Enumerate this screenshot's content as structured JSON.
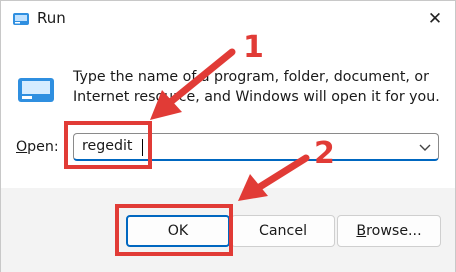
{
  "window": {
    "title": "Run",
    "close_label": "✕",
    "app_icon": "run-icon"
  },
  "body": {
    "icon": "run-icon",
    "description": "Type the name of a program, folder, document, or Internet resource, and Windows will open it for you."
  },
  "open_field": {
    "label_mnemonic": "O",
    "label_rest": "pen:",
    "value": "regedit",
    "dropdown_icon": "chevron-down-icon"
  },
  "buttons": {
    "ok": "OK",
    "cancel": "Cancel",
    "browse_mnemonic": "B",
    "browse_rest": "rowse..."
  },
  "annotations": {
    "step1": "1",
    "step2": "2",
    "color": "#e13b36"
  },
  "colors": {
    "accent": "#0067c0",
    "icon_blue": "#2f8fe0",
    "footer_bg": "#f3f3f3"
  }
}
